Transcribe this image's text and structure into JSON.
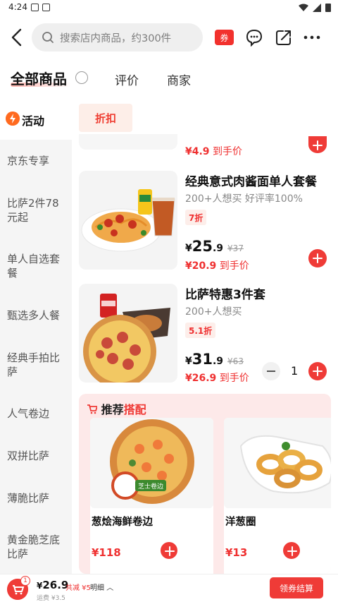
{
  "status_bar": {
    "time": "4:24"
  },
  "header": {
    "search_placeholder": "搜索店内商品，约300件",
    "coupon_label": "券"
  },
  "tabs": [
    {
      "label": "全部商品"
    },
    {
      "label": "评价"
    },
    {
      "label": "商家"
    }
  ],
  "sidebar": {
    "active": "活动",
    "items": [
      {
        "label": "京东专享"
      },
      {
        "label": "比萨2件78元起"
      },
      {
        "label": "单人自选套餐"
      },
      {
        "label": "甄选多人餐"
      },
      {
        "label": "经典手拍比萨"
      },
      {
        "label": "人气卷边"
      },
      {
        "label": "双拼比萨"
      },
      {
        "label": "薄脆比萨"
      },
      {
        "label": "黄金脆芝底比萨"
      }
    ]
  },
  "filter_chip": "折扣",
  "partial_item": {
    "final_price": "¥4.9",
    "final_suffix": "到手价"
  },
  "products": [
    {
      "name": "经典意式肉酱面单人套餐",
      "meta": "200+人想买 好评率100%",
      "badge": "7折",
      "price_symbol": "¥",
      "price_int": "25",
      "price_dec": ".9",
      "original_price": "¥37",
      "final_price": "¥20.9",
      "final_suffix": "到手价"
    },
    {
      "name": "比萨特惠3件套",
      "meta": "200+人想买",
      "badge": "5.1折",
      "price_symbol": "¥",
      "price_int": "31",
      "price_dec": ".9",
      "original_price": "¥63",
      "final_price": "¥26.9",
      "final_suffix": "到手价",
      "quantity": "1"
    }
  ],
  "recommend": {
    "title_prefix": "推荐",
    "title_highlight": "搭配",
    "items": [
      {
        "name": "葱烩海鲜卷边",
        "price": "¥118",
        "tag": "芝士卷边"
      },
      {
        "name": "洋葱圈",
        "price": "¥13"
      }
    ]
  },
  "bottom_bar": {
    "cart_count": "1",
    "total_symbol": "¥",
    "total": "26.9",
    "discount": "共减 ¥5",
    "detail": "明细",
    "shipping": "运费 ¥3.5",
    "checkout": "领券结算"
  }
}
